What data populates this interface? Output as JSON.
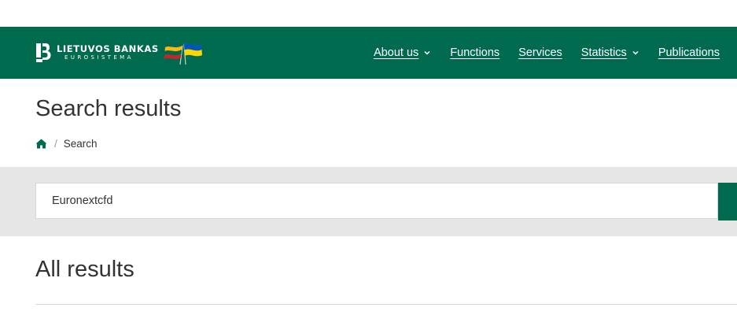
{
  "header": {
    "logo": {
      "title": "LIETUVOS BANKAS",
      "subtitle": "EUROSISTEMA",
      "icon": "lb-logo-icon",
      "flags": [
        "lithuania-flag-icon",
        "ukraine-flag-icon"
      ]
    },
    "nav": {
      "items": [
        {
          "label": "About us",
          "has_dropdown": true
        },
        {
          "label": "Functions",
          "has_dropdown": false
        },
        {
          "label": "Services",
          "has_dropdown": false
        },
        {
          "label": "Statistics",
          "has_dropdown": true
        },
        {
          "label": "Publications",
          "has_dropdown": false
        }
      ]
    }
  },
  "page": {
    "title": "Search results"
  },
  "breadcrumb": {
    "home_icon": "home-icon",
    "separator": "/",
    "current": "Search"
  },
  "search": {
    "value": "Euronextcfd"
  },
  "results": {
    "title": "All results"
  },
  "colors": {
    "brand_green": "#006a4e",
    "band_gray": "#e6e6e6",
    "text": "#333333"
  }
}
